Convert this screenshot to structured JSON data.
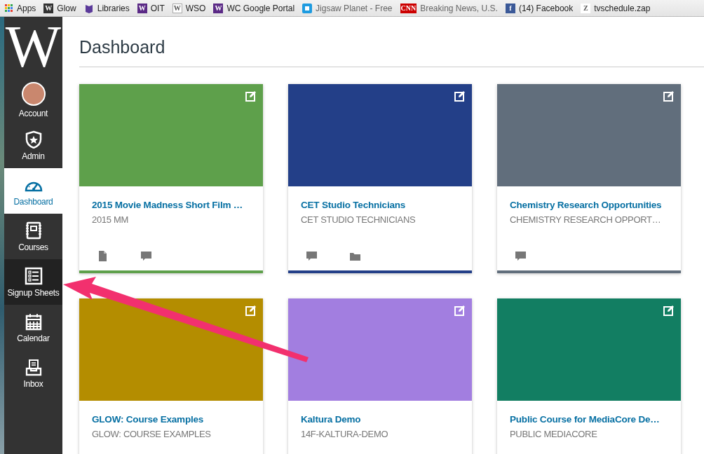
{
  "bookmarks": [
    {
      "label": "Apps",
      "kind": "grid"
    },
    {
      "label": "Glow",
      "kind": "letter",
      "glyph": "W",
      "color": "#333333"
    },
    {
      "label": "Libraries",
      "kind": "book"
    },
    {
      "label": "OIT",
      "kind": "letter",
      "glyph": "W",
      "color": "#5b2a86"
    },
    {
      "label": "WSO",
      "kind": "outline-letter",
      "glyph": "W",
      "color": "#ffffff"
    },
    {
      "label": "WC Google Portal",
      "kind": "letter",
      "glyph": "W",
      "color": "#5b2a86"
    },
    {
      "label": "Jigsaw Planet - Free",
      "kind": "puzzle",
      "faded": true
    },
    {
      "label": "Breaking News, U.S.",
      "kind": "letter",
      "glyph": "CNN",
      "color": "#cc0000",
      "faded": true
    },
    {
      "label": "(14) Facebook",
      "kind": "letter",
      "glyph": "f",
      "color": "#3b5998"
    },
    {
      "label": "tvschedule.zap",
      "kind": "letter",
      "glyph": "Z",
      "color": "#ffffff"
    }
  ],
  "sidebar": {
    "logo": "W",
    "items": [
      {
        "label": "Account",
        "kind": "avatar",
        "selected": false,
        "hovered": false
      },
      {
        "label": "Admin",
        "kind": "shield",
        "selected": false,
        "hovered": false
      },
      {
        "label": "Dashboard",
        "kind": "gauge",
        "selected": true,
        "hovered": false
      },
      {
        "label": "Courses",
        "kind": "notebook",
        "selected": false,
        "hovered": false
      },
      {
        "label": "Signup Sheets",
        "kind": "list",
        "selected": false,
        "hovered": true
      },
      {
        "label": "Calendar",
        "kind": "calendar",
        "selected": false,
        "hovered": false
      },
      {
        "label": "Inbox",
        "kind": "inbox",
        "selected": false,
        "hovered": false
      }
    ]
  },
  "page_title": "Dashboard",
  "cards": [
    {
      "title": "2015 Movie Madness Short Film …",
      "subtitle": "2015 MM",
      "color": "#5ea04b",
      "icons": [
        {
          "kind": "grades"
        },
        {
          "kind": "discussion"
        }
      ]
    },
    {
      "title": "CET Studio Technicians",
      "subtitle": "CET STUDIO TECHNICIANS",
      "color": "#233f88",
      "icons": [
        {
          "kind": "discussion"
        },
        {
          "kind": "files"
        }
      ]
    },
    {
      "title": "Chemistry Research Opportunities",
      "subtitle": "CHEMISTRY RESEARCH OPPORT…",
      "color": "#616e7c",
      "icons": [
        {
          "kind": "discussion"
        }
      ]
    },
    {
      "title": "GLOW: Course Examples",
      "subtitle": "GLOW: COURSE EXAMPLES",
      "color": "#b48d00"
    },
    {
      "title": "Kaltura Demo",
      "subtitle": "14F-KALTURA-DEMO",
      "color": "#a27ee0"
    },
    {
      "title": "Public Course for MediaCore De…",
      "subtitle": "PUBLIC MEDIACORE",
      "color": "#127e62"
    }
  ]
}
